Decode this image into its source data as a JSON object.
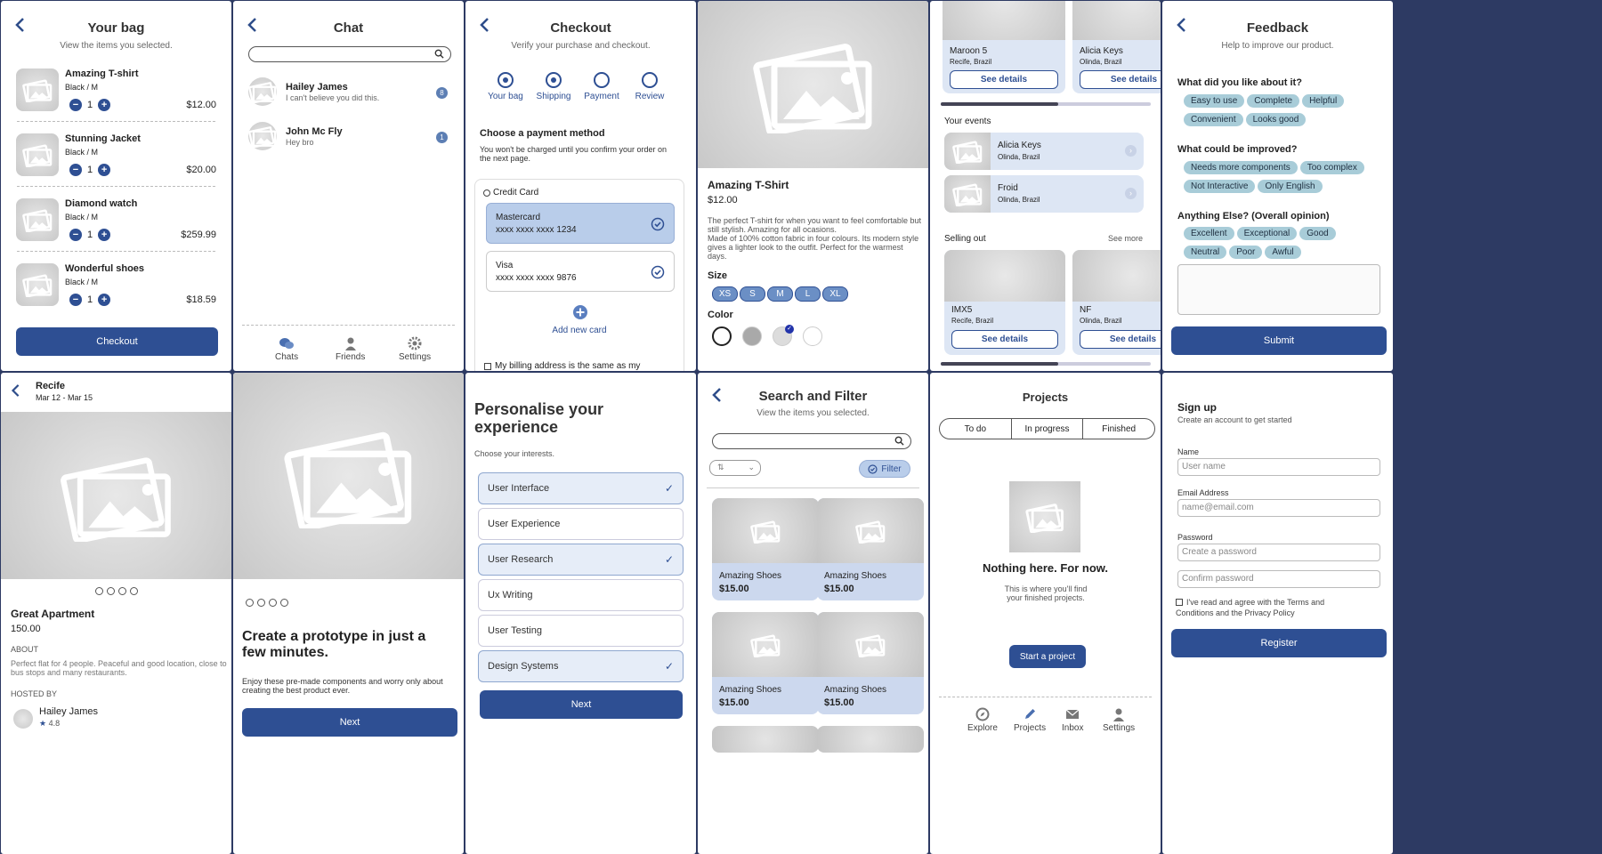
{
  "bag": {
    "title": "Your bag",
    "subtitle": "View the items you selected.",
    "items": [
      {
        "name": "Amazing T-shirt",
        "variant": "Black / M",
        "qty": "1",
        "price": "$12.00"
      },
      {
        "name": "Stunning Jacket",
        "variant": "Black / M",
        "qty": "1",
        "price": "$20.00"
      },
      {
        "name": "Diamond watch",
        "variant": "Black / M",
        "qty": "1",
        "price": "$259.99"
      },
      {
        "name": "Wonderful shoes",
        "variant": "Black / M",
        "qty": "1",
        "price": "$18.59"
      }
    ],
    "checkout": "Checkout"
  },
  "chat": {
    "title": "Chat",
    "contacts": [
      {
        "name": "Hailey James",
        "msg": "I can't believe you did this.",
        "badge": "8"
      },
      {
        "name": "John Mc Fly",
        "msg": "Hey bro",
        "badge": "1"
      }
    ],
    "nav": [
      "Chats",
      "Friends",
      "Settings"
    ]
  },
  "checkout": {
    "title": "Checkout",
    "subtitle": "Verify your purchase and checkout.",
    "steps": [
      "Your bag",
      "Shipping",
      "Payment",
      "Review"
    ],
    "heading": "Choose a payment method",
    "note": "You won't be charged until you confirm your order on the next page.",
    "method": "Credit Card",
    "cards": [
      {
        "brand": "Mastercard",
        "num": "xxxx xxxx xxxx 1234"
      },
      {
        "brand": "Visa",
        "num": "xxxx xxxx xxxx 9876"
      }
    ],
    "add": "Add new card",
    "billing": "My billing address is the same as my"
  },
  "product": {
    "name": "Amazing T-Shirt",
    "price": "$12.00",
    "desc": "The perfect T-shirt for when you want to feel comfortable but still stylish. Amazing for all ocasions.\nMade of 100% cotton fabric in four colours. Its modern style gives a lighter look to the outfit. Perfect for the warmest days.",
    "size_label": "Size",
    "sizes": [
      "XS",
      "S",
      "M",
      "L",
      "XL"
    ],
    "color_label": "Color",
    "colors": [
      "#ffffff",
      "#a9a9a9",
      "#dcdcdc",
      "#ffffff"
    ]
  },
  "events": {
    "top": [
      {
        "name": "Maroon 5",
        "loc": "Recife, Brazil"
      },
      {
        "name": "Alicia Keys",
        "loc": "Olinda, Brazil"
      }
    ],
    "see": "See details",
    "your_label": "Your events",
    "your": [
      {
        "name": "Alicia Keys",
        "loc": "Olinda, Brazil"
      },
      {
        "name": "Froid",
        "loc": "Olinda, Brazil"
      }
    ],
    "selling_label": "Selling out",
    "see_more": "See more",
    "selling": [
      {
        "name": "IMX5",
        "loc": "Recife, Brazil"
      },
      {
        "name": "NF",
        "loc": "Olinda, Brazil"
      }
    ]
  },
  "feedback": {
    "title": "Feedback",
    "subtitle": "Help to improve our product.",
    "q1": "What did you like about it?",
    "a1": [
      "Easy to use",
      "Complete",
      "Helpful",
      "Convenient",
      "Looks good"
    ],
    "q2": "What could be improved?",
    "a2": [
      "Needs more components",
      "Too complex",
      "Not Interactive",
      "Only English"
    ],
    "q3": "Anything Else? (Overall opinion)",
    "a3": [
      "Excellent",
      "Exceptional",
      "Good",
      "Neutral",
      "Poor",
      "Awful"
    ],
    "submit": "Submit"
  },
  "apt": {
    "city": "Recife",
    "dates": "Mar 12 - Mar 15",
    "name": "Great Apartment",
    "price": "150.00",
    "about_label": "ABOUT",
    "about": "Perfect flat for 4 people. Peaceful and good location, close to bus stops and many restaurants.",
    "host_label": "HOSTED BY",
    "host": "Hailey James",
    "rating": "4.8"
  },
  "onboard": {
    "title": "Create a prototype in just a few minutes.",
    "text": "Enjoy these pre-made components and worry only about creating the best product ever.",
    "next": "Next"
  },
  "personal": {
    "title": "Personalise your experience",
    "subtitle": "Choose your interests.",
    "items": [
      {
        "label": "User Interface",
        "on": true
      },
      {
        "label": "User Experience",
        "on": false
      },
      {
        "label": "User Research",
        "on": true
      },
      {
        "label": "Ux Writing",
        "on": false
      },
      {
        "label": "User Testing",
        "on": false
      },
      {
        "label": "Design Systems",
        "on": true
      }
    ],
    "next": "Next"
  },
  "search": {
    "title": "Search and Filter",
    "subtitle": "View the items you selected.",
    "filter": "Filter",
    "items": [
      {
        "name": "Amazing Shoes",
        "price": "$15.00"
      },
      {
        "name": "Amazing Shoes",
        "price": "$15.00"
      },
      {
        "name": "Amazing Shoes",
        "price": "$15.00"
      },
      {
        "name": "Amazing Shoes",
        "price": "$15.00"
      }
    ]
  },
  "projects": {
    "title": "Projects",
    "tabs": [
      "To do",
      "In progress",
      "Finished"
    ],
    "empty_title": "Nothing here. For now.",
    "empty_text": "This is where you'll find your finished projects.",
    "start": "Start a project",
    "nav": [
      "Explore",
      "Projects",
      "Inbox",
      "Settings"
    ]
  },
  "signup": {
    "title": "Sign up",
    "subtitle": "Create an account to get started",
    "name_label": "Name",
    "name_ph": "User name",
    "email_label": "Email Address",
    "email_ph": "name@email.com",
    "pw_label": "Password",
    "pw_ph": "Create a password",
    "pw2_ph": "Confirm password",
    "terms": "I've read and agree with the Terms and Conditions and the Privacy Policy",
    "register": "Register"
  }
}
